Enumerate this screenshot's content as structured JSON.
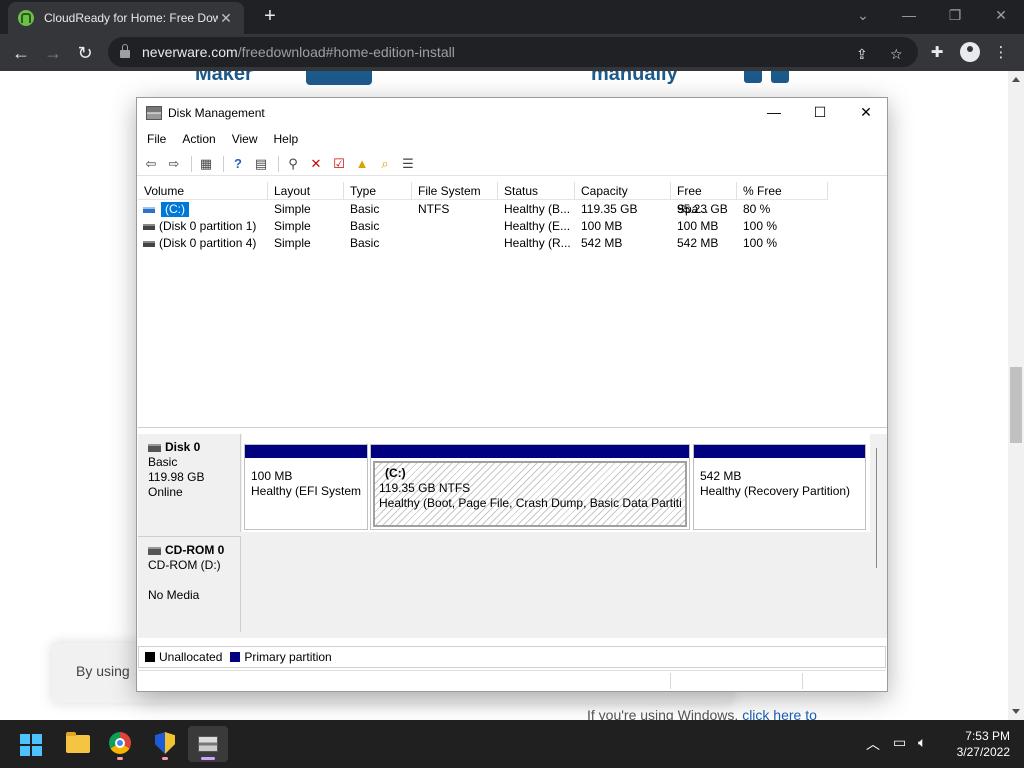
{
  "browser": {
    "tab_title": "CloudReady for Home: Free Dow",
    "tab_close": "✕",
    "new_tab": "+",
    "url_host": "neverware.com",
    "url_path": "/freedownload#home-edition-install",
    "controls": {
      "minimize": "—",
      "restore": "❐",
      "close": "✕",
      "tab_search": "⌄"
    }
  },
  "webpage": {
    "heading_left": "Maker",
    "heading_right": "manually",
    "cookie_text": "By using",
    "bottom_text": "If you're using Windows,",
    "bottom_link": "click here to"
  },
  "dm": {
    "title": "Disk Management",
    "menu": [
      "File",
      "Action",
      "View",
      "Help"
    ],
    "columns": [
      "Volume",
      "Layout",
      "Type",
      "File System",
      "Status",
      "Capacity",
      "Free Spa...",
      "% Free"
    ],
    "volumes": [
      {
        "volume": "(C:)",
        "layout": "Simple",
        "type": "Basic",
        "fs": "NTFS",
        "status": "Healthy (B...",
        "capacity": "119.35 GB",
        "free": "95.23 GB",
        "pct": "80 %"
      },
      {
        "volume": "(Disk 0 partition 1)",
        "layout": "Simple",
        "type": "Basic",
        "fs": "",
        "status": "Healthy (E...",
        "capacity": "100 MB",
        "free": "100 MB",
        "pct": "100 %"
      },
      {
        "volume": "(Disk 0 partition 4)",
        "layout": "Simple",
        "type": "Basic",
        "fs": "",
        "status": "Healthy (R...",
        "capacity": "542 MB",
        "free": "542 MB",
        "pct": "100 %"
      }
    ],
    "disk0": {
      "name": "Disk 0",
      "type": "Basic",
      "size": "119.98 GB",
      "state": "Online",
      "partitions": [
        {
          "title": "",
          "line1": "100 MB",
          "line2": "Healthy (EFI System P"
        },
        {
          "title": "(C:)",
          "line1": "119.35 GB NTFS",
          "line2": "Healthy (Boot, Page File, Crash Dump, Basic Data Partition"
        },
        {
          "title": "",
          "line1": "542 MB",
          "line2": "Healthy (Recovery Partition)"
        }
      ]
    },
    "cdrom": {
      "name": "CD-ROM 0",
      "drive": "CD-ROM (D:)",
      "media": "No Media"
    },
    "legend": [
      {
        "label": "Unallocated",
        "color": "#000000"
      },
      {
        "label": "Primary partition",
        "color": "#000080"
      }
    ]
  },
  "taskbar": {
    "time": "7:53 PM",
    "date": "3/27/2022"
  }
}
